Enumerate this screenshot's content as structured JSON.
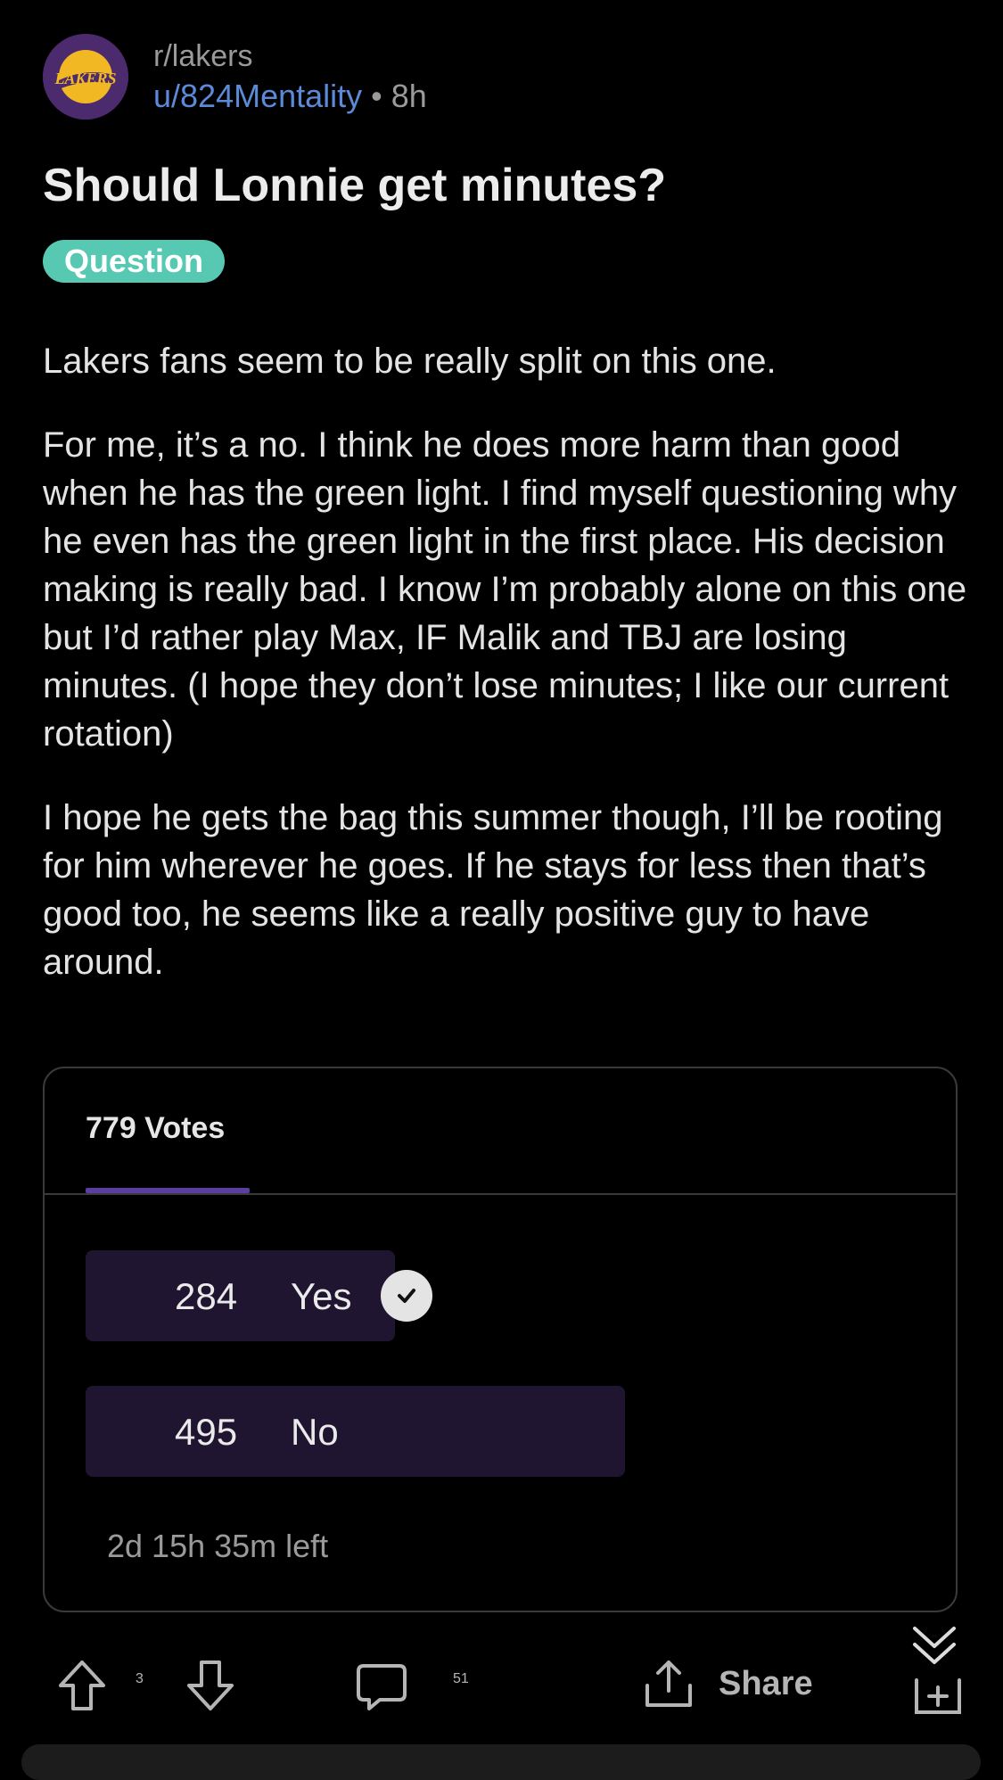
{
  "post": {
    "subreddit": "r/lakers",
    "username": "u/824Mentality",
    "separator": "•",
    "age": "8h",
    "title": "Should Lonnie get minutes?",
    "flair": "Question",
    "paragraphs": [
      "Lakers fans seem to be really split on this one.",
      "For me, it’s a no. I think he does more harm than good when he has the green light. I find myself questioning why he even has the green light in the first place. His decision making is really bad. I know I’m probably alone on this one but I’d rather play Max, IF Malik and TBJ are losing minutes. (I hope they don’t lose minutes; I like our current rotation)",
      "I hope he gets the bag this summer though, I’ll be rooting for him wherever he goes. If he stays for less then that’s good too, he seems like a really positive guy to have around."
    ]
  },
  "poll": {
    "total_votes_label": "779 Votes",
    "options": [
      {
        "count": "284",
        "label": "Yes",
        "share": 0.365,
        "selected": true
      },
      {
        "count": "495",
        "label": "No",
        "share": 0.635,
        "selected": false
      }
    ],
    "time_left": "2d 15h 35m left"
  },
  "actions": {
    "upvotes": "3",
    "comments": "51",
    "share_label": "Share"
  },
  "icons": {
    "avatar": "lakers-logo",
    "upvote": "arrow-up-icon",
    "downvote": "arrow-down-icon",
    "comment": "comment-bubble-icon",
    "share": "share-icon",
    "collapse": "double-chevron-down-icon",
    "award": "add-award-icon"
  },
  "colors": {
    "background": "#000000",
    "username": "#5b8bd8",
    "flair": "#57c9b2",
    "poll_bar": "#1f1530",
    "tab_underline": "#5b3fa0"
  }
}
